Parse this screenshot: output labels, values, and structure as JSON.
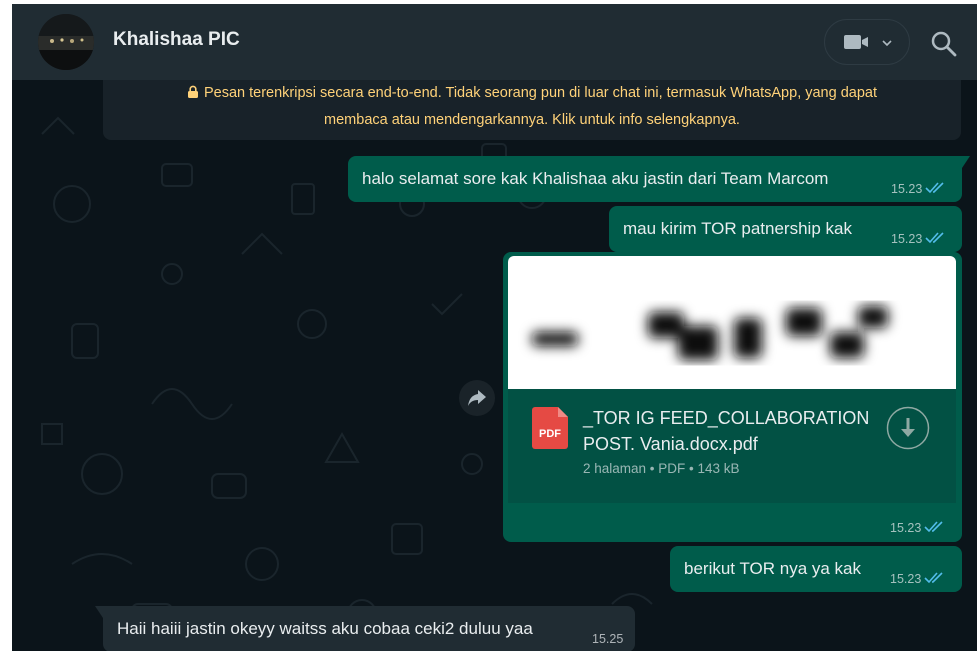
{
  "header": {
    "contact_name": "Khalishaa PIC"
  },
  "encryption_notice": {
    "line1": "Pesan terenkripsi secara end-to-end. Tidak seorang pun di luar chat ini, termasuk WhatsApp, yang dapat",
    "line2": "membaca atau mendengarkannya. Klik untuk info selengkapnya."
  },
  "messages": [
    {
      "direction": "out",
      "text": "halo selamat sore kak Khalishaa aku jastin dari Team Marcom",
      "time": "15.23",
      "status": "read"
    },
    {
      "direction": "out",
      "text": "mau kirim TOR patnership kak",
      "time": "15.23",
      "status": "read"
    },
    {
      "direction": "out",
      "type": "document",
      "file_name_line1": "_TOR IG FEED_COLLABORATION",
      "file_name_line2": "POST. Vania.docx.pdf",
      "file_meta": "2 halaman • PDF • 143 kB",
      "file_badge": "PDF",
      "time": "15.23",
      "status": "read"
    },
    {
      "direction": "out",
      "text": "berikut TOR nya ya kak",
      "time": "15.23",
      "status": "read"
    },
    {
      "direction": "in",
      "text": "Haii haiii jastin okeyy waitss aku cobaa ceki2 duluu yaa",
      "time": "15.25"
    }
  ],
  "colors": {
    "chat_bg": "#0b141a",
    "header_bg": "#202c33",
    "outgoing_bubble": "#005c4b",
    "incoming_bubble": "#202c33",
    "read_tick": "#53bdeb",
    "encryption_text": "#ffd279",
    "pdf_red": "#e54a44"
  }
}
